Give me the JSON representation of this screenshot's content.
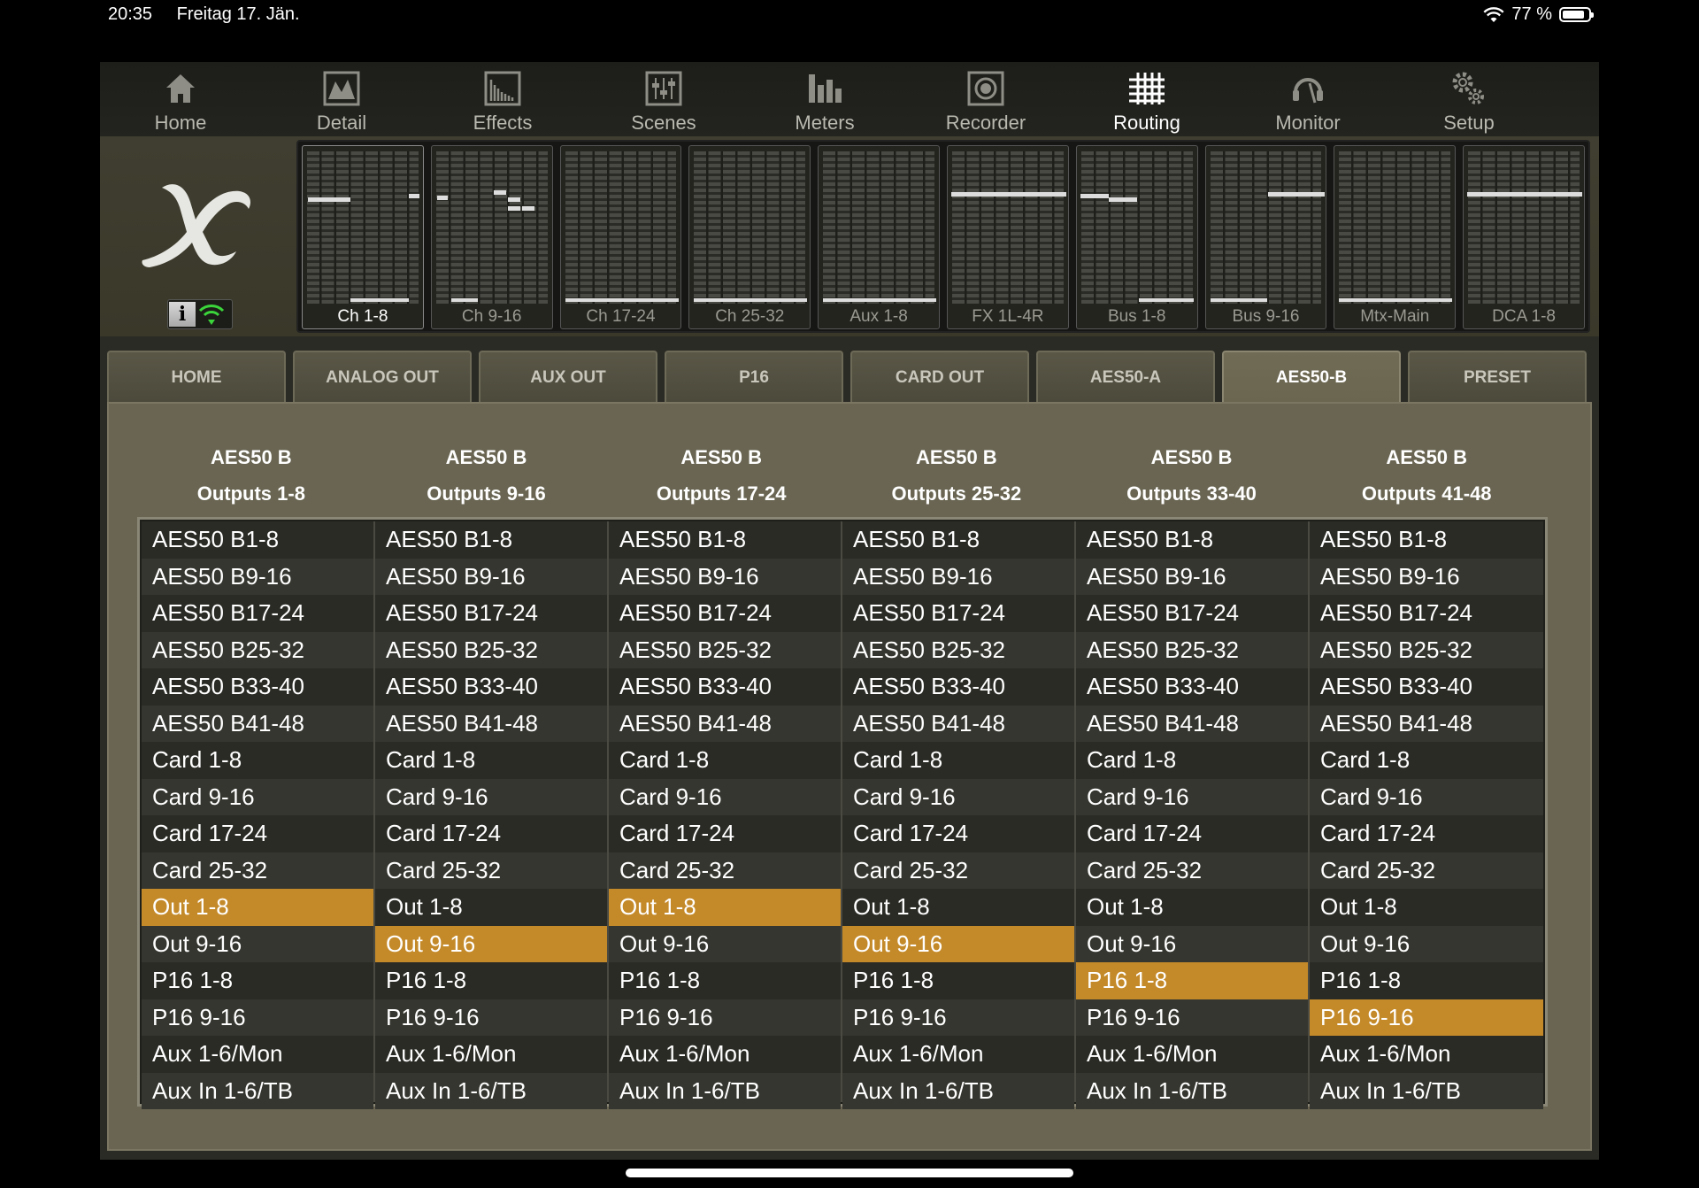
{
  "status_bar": {
    "time": "20:35",
    "date": "Freitag 17. Jän.",
    "battery": "77 %"
  },
  "nav": [
    {
      "label": "Home",
      "icon": "home-icon"
    },
    {
      "label": "Detail",
      "icon": "detail-icon"
    },
    {
      "label": "Effects",
      "icon": "effects-icon"
    },
    {
      "label": "Scenes",
      "icon": "scenes-icon"
    },
    {
      "label": "Meters",
      "icon": "meters-icon"
    },
    {
      "label": "Recorder",
      "icon": "recorder-icon"
    },
    {
      "label": "Routing",
      "icon": "routing-icon",
      "active": true
    },
    {
      "label": "Monitor",
      "icon": "monitor-icon"
    },
    {
      "label": "Setup",
      "icon": "setup-icon"
    }
  ],
  "info_button": {
    "label": "i"
  },
  "meters": [
    "Ch 1-8",
    "Ch 9-16",
    "Ch 17-24",
    "Ch 25-32",
    "Aux 1-8",
    "FX 1L-4R",
    "Bus 1-8",
    "Bus 9-16",
    "Mtx-Main",
    "DCA 1-8"
  ],
  "tabs": [
    "HOME",
    "ANALOG OUT",
    "AUX OUT",
    "P16",
    "CARD OUT",
    "AES50-A",
    "AES50-B",
    "PRESET"
  ],
  "active_tab": "AES50-B",
  "columns": [
    {
      "title": "AES50 B",
      "subtitle": "Outputs 1-8",
      "selected": "Out 1-8"
    },
    {
      "title": "AES50 B",
      "subtitle": "Outputs 9-16",
      "selected": "Out 9-16"
    },
    {
      "title": "AES50 B",
      "subtitle": "Outputs 17-24",
      "selected": "Out 1-8"
    },
    {
      "title": "AES50 B",
      "subtitle": "Outputs 25-32",
      "selected": "Out 9-16"
    },
    {
      "title": "AES50 B",
      "subtitle": "Outputs 33-40",
      "selected": "P16 1-8"
    },
    {
      "title": "AES50 B",
      "subtitle": "Outputs 41-48",
      "selected": "P16 9-16"
    }
  ],
  "options": [
    "AES50 B1-8",
    "AES50 B9-16",
    "AES50 B17-24",
    "AES50 B25-32",
    "AES50 B33-40",
    "AES50 B41-48",
    "Card 1-8",
    "Card 9-16",
    "Card 17-24",
    "Card 25-32",
    "Out 1-8",
    "Out 9-16",
    "P16 1-8",
    "P16 9-16",
    "Aux 1-6/Mon",
    "Aux In 1-6/TB"
  ],
  "colors": {
    "accent": "#c48a2a",
    "panel": "#696552",
    "header": "#403e30"
  }
}
